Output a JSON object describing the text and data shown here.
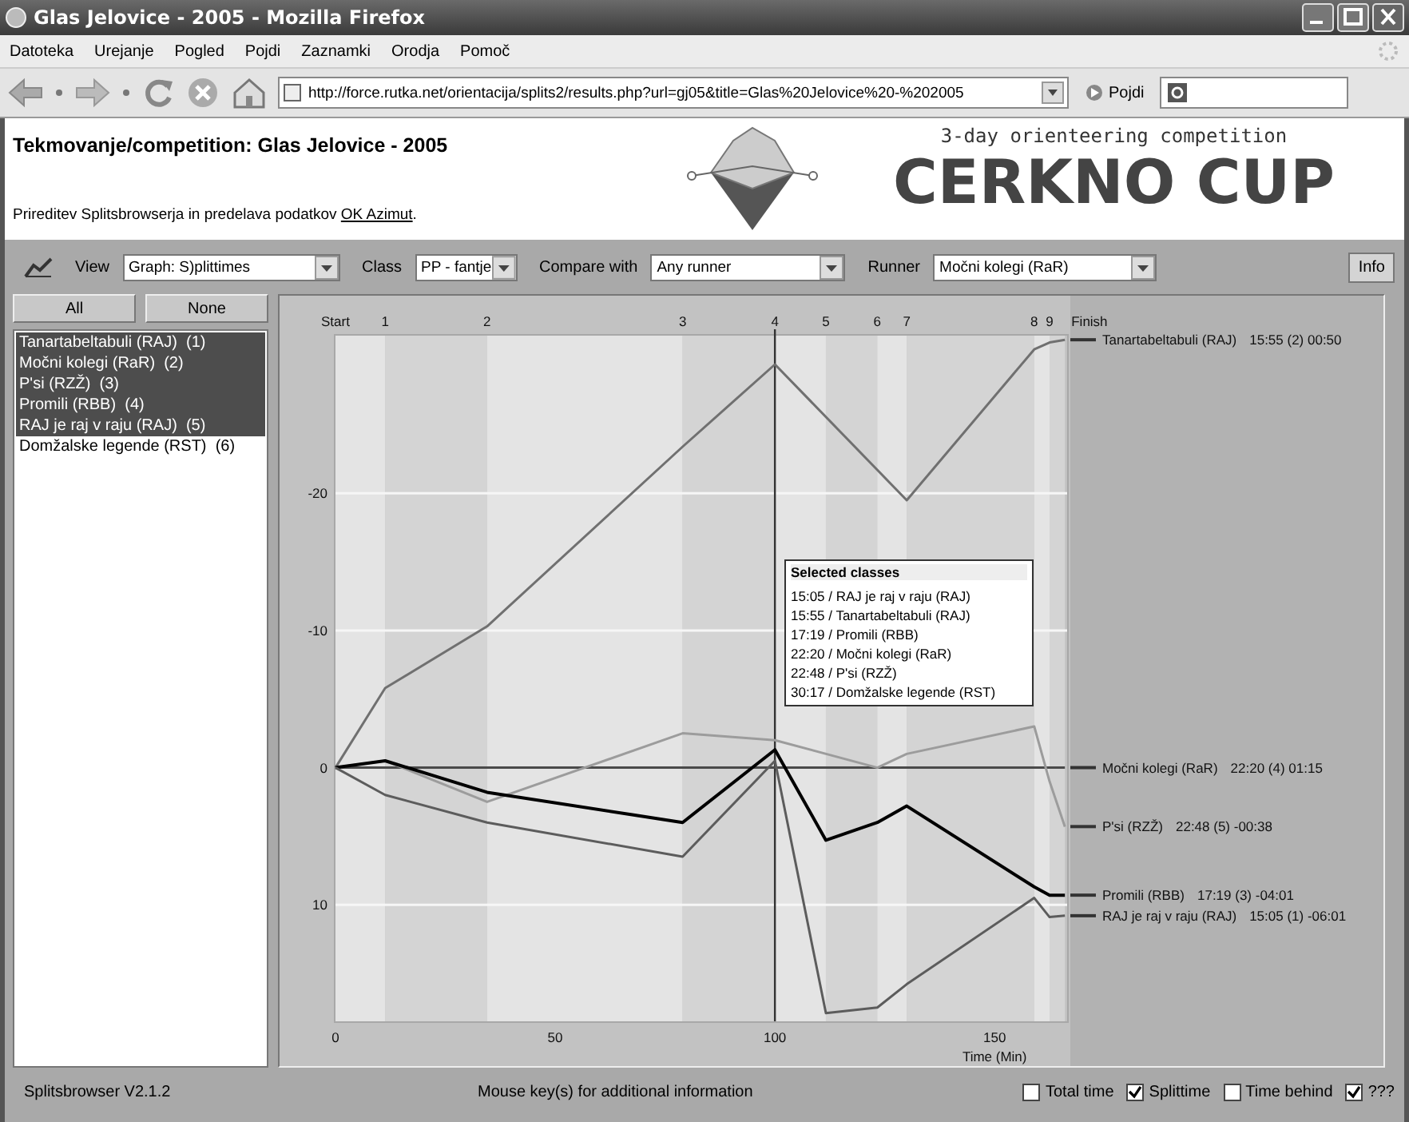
{
  "window": {
    "title": "Glas Jelovice - 2005 - Mozilla Firefox"
  },
  "menu": [
    "Datoteka",
    "Urejanje",
    "Pogled",
    "Pojdi",
    "Zaznamki",
    "Orodja",
    "Pomoč"
  ],
  "navigation": {
    "url": "http://force.rutka.net/orientacija/splits2/results.php?url=gj05&title=Glas%20Jelovice%20-%202005",
    "go_button": "Pojdi"
  },
  "page": {
    "title": "Tekmovanje/competition: Glas Jelovice - 2005",
    "credit": {
      "text": "Prireditev Splitsbrowserja in predelava podatkov ",
      "link": "OK Azimut",
      "after": "."
    },
    "banner": {
      "subtitle": "3-day orienteering competition",
      "title": "CERKNO CUP"
    }
  },
  "toolbar": {
    "fields": [
      {
        "label": "View",
        "value": "Graph: S)plittimes"
      },
      {
        "label": "Class",
        "value": "PP - fantje"
      },
      {
        "label": "Compare with",
        "value": "Any runner"
      },
      {
        "label": "Runner",
        "value": "Močni kolegi (RaR)"
      }
    ],
    "info_button": "Info"
  },
  "sidebar": {
    "buttons": [
      "All",
      "None"
    ],
    "runners": [
      {
        "name": "Tanartabeltabuli (RAJ)  (1)",
        "selected": true
      },
      {
        "name": "Močni kolegi (RaR)  (2)",
        "selected": true
      },
      {
        "name": "P'si (RZŽ)  (3)",
        "selected": true
      },
      {
        "name": "Promili (RBB)  (4)",
        "selected": true
      },
      {
        "name": "RAJ je raj v raju (RAJ)  (5)",
        "selected": true
      },
      {
        "name": "Domžalske legende (RST)  (6)",
        "selected": false
      }
    ]
  },
  "chart": {
    "chart_data": {
      "type": "line",
      "xlabel": "Time (Min)",
      "x": [
        0,
        11.3,
        34.5,
        79,
        100,
        111.6,
        123.3,
        130,
        159,
        162.5,
        166
      ],
      "xlim": [
        0,
        166.5
      ],
      "ylim": [
        18.5,
        -31.5
      ],
      "grid": true,
      "xticks": [
        0,
        50,
        100,
        150
      ],
      "yticks": [
        -20,
        -10,
        0,
        10
      ],
      "series": [
        {
          "name": "Tanartabeltabuli (RAJ)",
          "color": "#707070",
          "values": [
            0,
            -5.8,
            -10.3,
            -23.4,
            -29.4,
            null,
            null,
            -19.5,
            -30.5,
            -31,
            -31.2
          ]
        },
        {
          "name": "Močni kolegi (RaR)",
          "color": "#4a4a4a",
          "values": [
            0,
            0,
            0,
            0,
            0,
            0,
            0,
            0,
            0,
            0,
            0
          ]
        },
        {
          "name": "P'si (RZŽ)",
          "color": "#9c9c9c",
          "values": [
            0,
            -0.5,
            2.5,
            -2.5,
            -2,
            null,
            0,
            -1,
            -3,
            1,
            4.3
          ]
        },
        {
          "name": "Promili (RBB)",
          "color": "#000000",
          "values": [
            0,
            -0.5,
            1.8,
            4,
            -1.3,
            5.3,
            4,
            2.8,
            8.7,
            9.3,
            9.3
          ]
        },
        {
          "name": "RAJ je raj v raju (RAJ)",
          "color": "#5c5c5c",
          "values": [
            0,
            2,
            4,
            6.5,
            -0.5,
            17.9,
            17.5,
            15.8,
            9.5,
            10.9,
            10.8
          ]
        }
      ],
      "annotations": [
        "Start",
        "1",
        "2",
        "3",
        "4",
        "5",
        "6",
        "7",
        "8",
        "9",
        "Finish"
      ],
      "ref_lines": [
        {
          "axis": "x",
          "value": 100
        }
      ],
      "bands": [
        {
          "axis": "x",
          "from": 0,
          "to": 11.3,
          "color": "#e4e4e4"
        },
        {
          "axis": "x",
          "from": 11.3,
          "to": 34.5,
          "color": "#d4d4d4"
        },
        {
          "axis": "x",
          "from": 34.5,
          "to": 79,
          "color": "#e4e4e4"
        },
        {
          "axis": "x",
          "from": 79,
          "to": 100,
          "color": "#d4d4d4"
        },
        {
          "axis": "x",
          "from": 100,
          "to": 111.6,
          "color": "#e4e4e4"
        },
        {
          "axis": "x",
          "from": 111.6,
          "to": 123.3,
          "color": "#d4d4d4"
        },
        {
          "axis": "x",
          "from": 123.3,
          "to": 130,
          "color": "#e4e4e4"
        },
        {
          "axis": "x",
          "from": 130,
          "to": 159,
          "color": "#d4d4d4"
        },
        {
          "axis": "x",
          "from": 159,
          "to": 162.5,
          "color": "#e4e4e4"
        },
        {
          "axis": "x",
          "from": 162.5,
          "to": 166,
          "color": "#d4d4d4"
        }
      ]
    },
    "end_results": [
      "15:55 (2) 00:50",
      "22:20 (4) 01:15",
      "22:48 (5) -00:38",
      "17:19 (3) -04:01",
      "15:05 (1) -06:01"
    ],
    "tooltip": {
      "title": "Selected classes",
      "lines": [
        "15:05 / RAJ je raj v raju (RAJ)",
        "15:55 / Tanartabeltabuli (RAJ)",
        "17:19 / Promili (RBB)",
        "22:20 / Močni kolegi (RaR)",
        "22:48 / P'si (RZŽ)",
        "30:17 / Domžalske legende (RST)"
      ]
    }
  },
  "status": {
    "version": "Splitsbrowser V2.1.2",
    "hint": "Mouse key(s) for additional information",
    "options": [
      {
        "label": "Total time",
        "checked": false
      },
      {
        "label": "Splittime",
        "checked": true
      },
      {
        "label": "Time behind",
        "checked": false
      },
      {
        "label": "???",
        "checked": true
      }
    ]
  }
}
